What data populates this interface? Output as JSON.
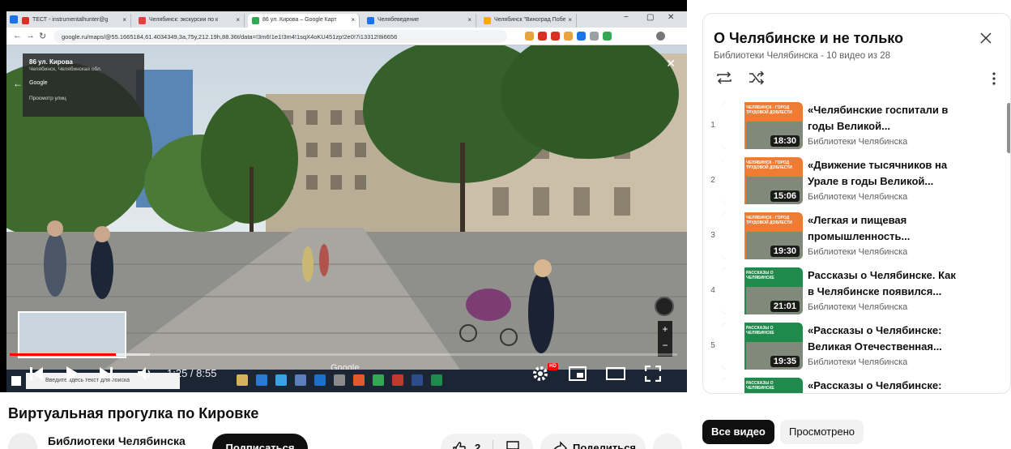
{
  "video": {
    "title": "Виртуальная прогулка по Кировке",
    "current_time": "1:25",
    "duration": "8:55",
    "time_display": "1:25 / 8:55",
    "progress_fraction": 0.159,
    "loaded_fraction": 0.21,
    "hd_badge": "HD"
  },
  "captured_screen": {
    "tabs": [
      {
        "label": "ТЕСТ - instrumentalhunter@g",
        "color": "#d93025"
      },
      {
        "label": "Челябинск: экскурсии по к",
        "color": "#e24141"
      },
      {
        "label": "86 ул. Кирова – Google Карт",
        "color": "#34a853",
        "active": true
      },
      {
        "label": "Челябеведение",
        "color": "#1a73e8"
      },
      {
        "label": "Челябинск \"Виноград Побе",
        "color": "#f9ab00"
      }
    ],
    "url": "google.ru/maps/@55.1665184,61.4034349,3a,75y,212.19h,88.36t/data=!3m6!1e1!3m4!1sqX4oKU451zp!2e0!7i13312!8i6656",
    "streetview_card": {
      "title": "86 ул. Кирова",
      "subtitle": "Челябинск, Челябинская обл.",
      "brand": "Google",
      "view_label": "Просмотр улиц"
    },
    "watermark": "Google",
    "taskbar_search": "Введите здесь текст для поиска"
  },
  "channel": {
    "name": "Библиотеки Челябинска",
    "subscribe_label": "Подписаться"
  },
  "actions": {
    "like_count": "2",
    "share_label": "Поделиться",
    "more_label": "..."
  },
  "playlist": {
    "title": "О Челябинске и не только",
    "subtitle": "Библиотеки Челябинска - 10 видео из 28",
    "items": [
      {
        "index": "1",
        "title_line1": "«Челябинские госпитали в",
        "title_line2": "годы Великой...",
        "channel": "Библиотеки Челябинска",
        "duration": "18:30",
        "thumb_heading": "ЧЕЛЯБИНСК - ГОРОД ТРУДОВОЙ ДОБЛЕСТИ",
        "thumb_color": "#f07b32"
      },
      {
        "index": "2",
        "title_line1": "«Движение тысячников на",
        "title_line2": "Урале в годы Великой...",
        "channel": "Библиотеки Челябинска",
        "duration": "15:06",
        "thumb_heading": "ЧЕЛЯБИНСК - ГОРОД ТРУДОВОЙ ДОБЛЕСТИ",
        "thumb_color": "#f07b32"
      },
      {
        "index": "3",
        "title_line1": "«Легкая и пищевая",
        "title_line2": "промышленность...",
        "channel": "Библиотеки Челябинска",
        "duration": "19:30",
        "thumb_heading": "ЧЕЛЯБИНСК - ГОРОД ТРУДОВОЙ ДОБЛЕСТИ",
        "thumb_color": "#f07b32"
      },
      {
        "index": "4",
        "title_line1": "Рассказы о Челябинске. Как",
        "title_line2": "в Челябинске появился...",
        "channel": "Библиотеки Челябинска",
        "duration": "21:01",
        "thumb_heading": "РАССКАЗЫ О ЧЕЛЯБИНСКЕ",
        "thumb_color": "#1f8a4c"
      },
      {
        "index": "5",
        "title_line1": "«Рассказы о Челябинске:",
        "title_line2": "Великая Отечественная...",
        "channel": "Библиотеки Челябинска",
        "duration": "19:35",
        "thumb_heading": "РАССКАЗЫ О ЧЕЛЯБИНСКЕ",
        "thumb_color": "#1f8a4c"
      },
      {
        "index": "",
        "title_line1": "«Рассказы о Челябинске:",
        "title_line2": "",
        "channel": "",
        "duration": "",
        "thumb_heading": "РАССКАЗЫ О ЧЕЛЯБИНСКЕ",
        "thumb_color": "#1f8a4c"
      }
    ]
  },
  "chips": {
    "all_videos": "Все видео",
    "watched": "Просмотрено"
  },
  "colors": {
    "progress": "#ff0000",
    "accent_dark": "#0f0f0f",
    "orange_thumb": "#f07b32",
    "green_thumb": "#1f8a4c"
  }
}
